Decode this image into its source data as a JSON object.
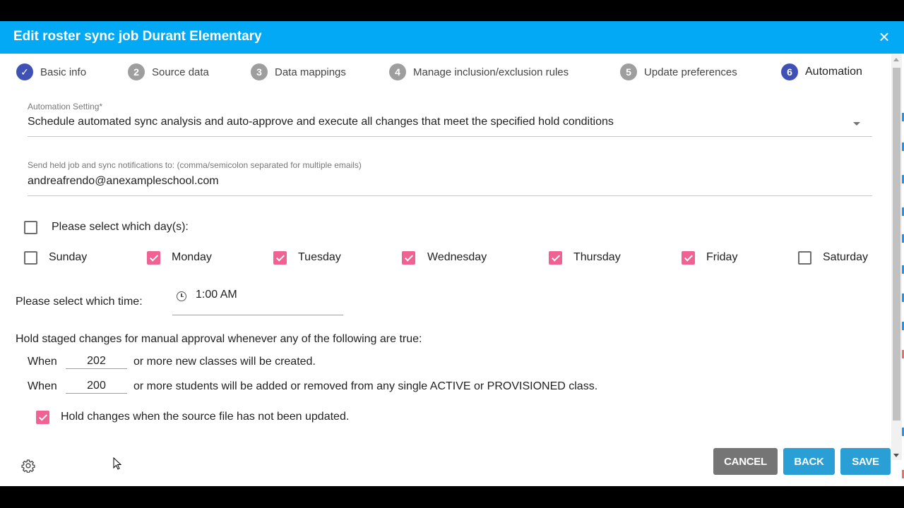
{
  "dialog": {
    "title": "Edit roster sync job Durant Elementary",
    "close_icon": "×"
  },
  "steps": [
    {
      "number": "✓",
      "label": "Basic info",
      "state": "completed"
    },
    {
      "number": "2",
      "label": "Source data",
      "state": "inactive"
    },
    {
      "number": "3",
      "label": "Data mappings",
      "state": "inactive"
    },
    {
      "number": "4",
      "label": "Manage inclusion/exclusion rules",
      "state": "inactive"
    },
    {
      "number": "5",
      "label": "Update preferences",
      "state": "inactive"
    },
    {
      "number": "6",
      "label": "Automation",
      "state": "current"
    }
  ],
  "automation": {
    "setting_label": "Automation Setting*",
    "setting_value": "Schedule automated sync analysis and auto-approve and execute all changes that meet the specified hold conditions",
    "notify_label": "Send held job and sync notifications to: (comma/semicolon separated for multiple emails)",
    "notify_value": "andreafrendo@anexampleschool.com"
  },
  "days": {
    "select_all_label": "Please select which day(s):",
    "select_all_checked": false,
    "items": [
      {
        "label": "Sunday",
        "checked": false
      },
      {
        "label": "Monday",
        "checked": true
      },
      {
        "label": "Tuesday",
        "checked": true
      },
      {
        "label": "Wednesday",
        "checked": true
      },
      {
        "label": "Thursday",
        "checked": true
      },
      {
        "label": "Friday",
        "checked": true
      },
      {
        "label": "Saturday",
        "checked": false
      }
    ]
  },
  "time": {
    "label": "Please select which time:",
    "value": "1:00 AM"
  },
  "hold": {
    "heading": "Hold staged changes for manual approval whenever any of the following are true:",
    "when_label": "When",
    "classes_value": "202",
    "classes_text": "or more new classes will be created.",
    "students_value": "200",
    "students_text": "or more students will be added or removed from any single ACTIVE or PROVISIONED class.",
    "source_checked": true,
    "source_label": "Hold changes when the source file has not been updated."
  },
  "buttons": {
    "cancel": "CANCEL",
    "back": "BACK",
    "save": "SAVE"
  },
  "colors": {
    "header": "#03a9f4",
    "step_active": "#3f51b5",
    "step_inactive": "#9e9e9e",
    "checkbox_checked": "#f06292",
    "button_primary": "#2a9fd6",
    "button_cancel": "#757575"
  }
}
